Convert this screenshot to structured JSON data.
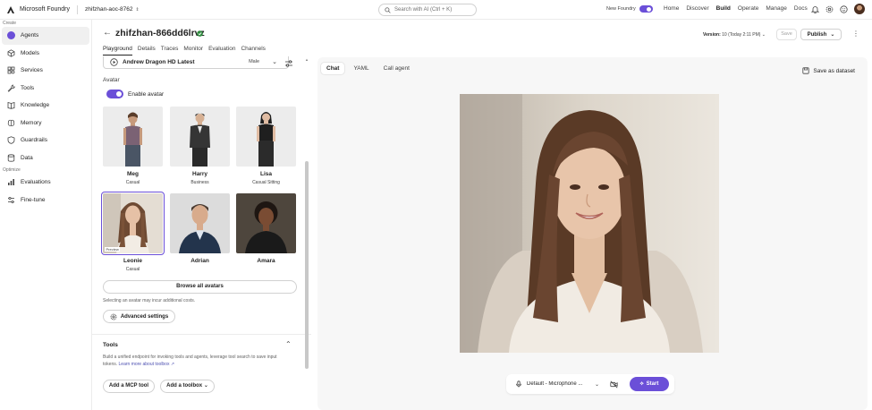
{
  "topbar": {
    "brand": "Microsoft Foundry",
    "project": "zhifzhan-aoc-8762",
    "search_placeholder": "Search with AI (Ctrl + K)",
    "new_foundry_label": "New Foundry",
    "nav": [
      "Home",
      "Discover",
      "Build",
      "Operate",
      "Manage",
      "Docs"
    ],
    "active_nav": "Build"
  },
  "sidebar": {
    "create_label": "Create",
    "optimize_label": "Optimize",
    "items": [
      {
        "label": "Agents",
        "icon": "agents-icon"
      },
      {
        "label": "Models",
        "icon": "models-icon"
      },
      {
        "label": "Services",
        "icon": "services-icon"
      },
      {
        "label": "Tools",
        "icon": "tools-icon"
      },
      {
        "label": "Knowledge",
        "icon": "knowledge-icon"
      },
      {
        "label": "Memory",
        "icon": "memory-icon"
      },
      {
        "label": "Guardrails",
        "icon": "guardrails-icon"
      },
      {
        "label": "Data",
        "icon": "data-icon"
      }
    ],
    "optimize_items": [
      {
        "label": "Evaluations",
        "icon": "evaluations-icon"
      },
      {
        "label": "Fine-tune",
        "icon": "fine-tune-icon"
      }
    ]
  },
  "agent": {
    "title": "zhifzhan-866dd6lrvz",
    "version_label": "Version:",
    "version_value": "10 (Today 2:11 PM)",
    "save_label": "Save",
    "publish_label": "Publish",
    "tabs": [
      "Playground",
      "Details",
      "Traces",
      "Monitor",
      "Evaluation",
      "Channels"
    ],
    "active_tab": "Playground"
  },
  "config": {
    "voice_name": "Andrew Dragon HD Latest",
    "voice_gender": "Male",
    "avatar_section": "Avatar",
    "enable_avatar": "Enable avatar",
    "avatars": [
      {
        "name": "Meg",
        "style": "Casual"
      },
      {
        "name": "Harry",
        "style": "Business"
      },
      {
        "name": "Lisa",
        "style": "Casual Sitting"
      },
      {
        "name": "Leonie",
        "style": "Casual",
        "badge": "Preview"
      },
      {
        "name": "Adrian",
        "style": ""
      },
      {
        "name": "Amara",
        "style": ""
      }
    ],
    "browse_label": "Browse all avatars",
    "cost_note": "Selecting an avatar may incur additional costs.",
    "advanced_label": "Advanced settings",
    "tools_title": "Tools",
    "tools_desc": "Build a unified endpoint for invoking tools and agents, leverage tool search to save input tokens.",
    "tools_link": "Learn more about toolbox",
    "add_mcp_label": "Add a MCP tool",
    "add_toolbox_label": "Add a toolbox"
  },
  "preview": {
    "tabs": [
      "Chat",
      "YAML",
      "Call agent"
    ],
    "active_tab": "Chat",
    "save_dataset": "Save as dataset",
    "mic_label": "Default - Microphone ...",
    "start_label": "Start"
  },
  "colors": {
    "accent": "#6b4fd8",
    "link": "#4f52b2"
  }
}
